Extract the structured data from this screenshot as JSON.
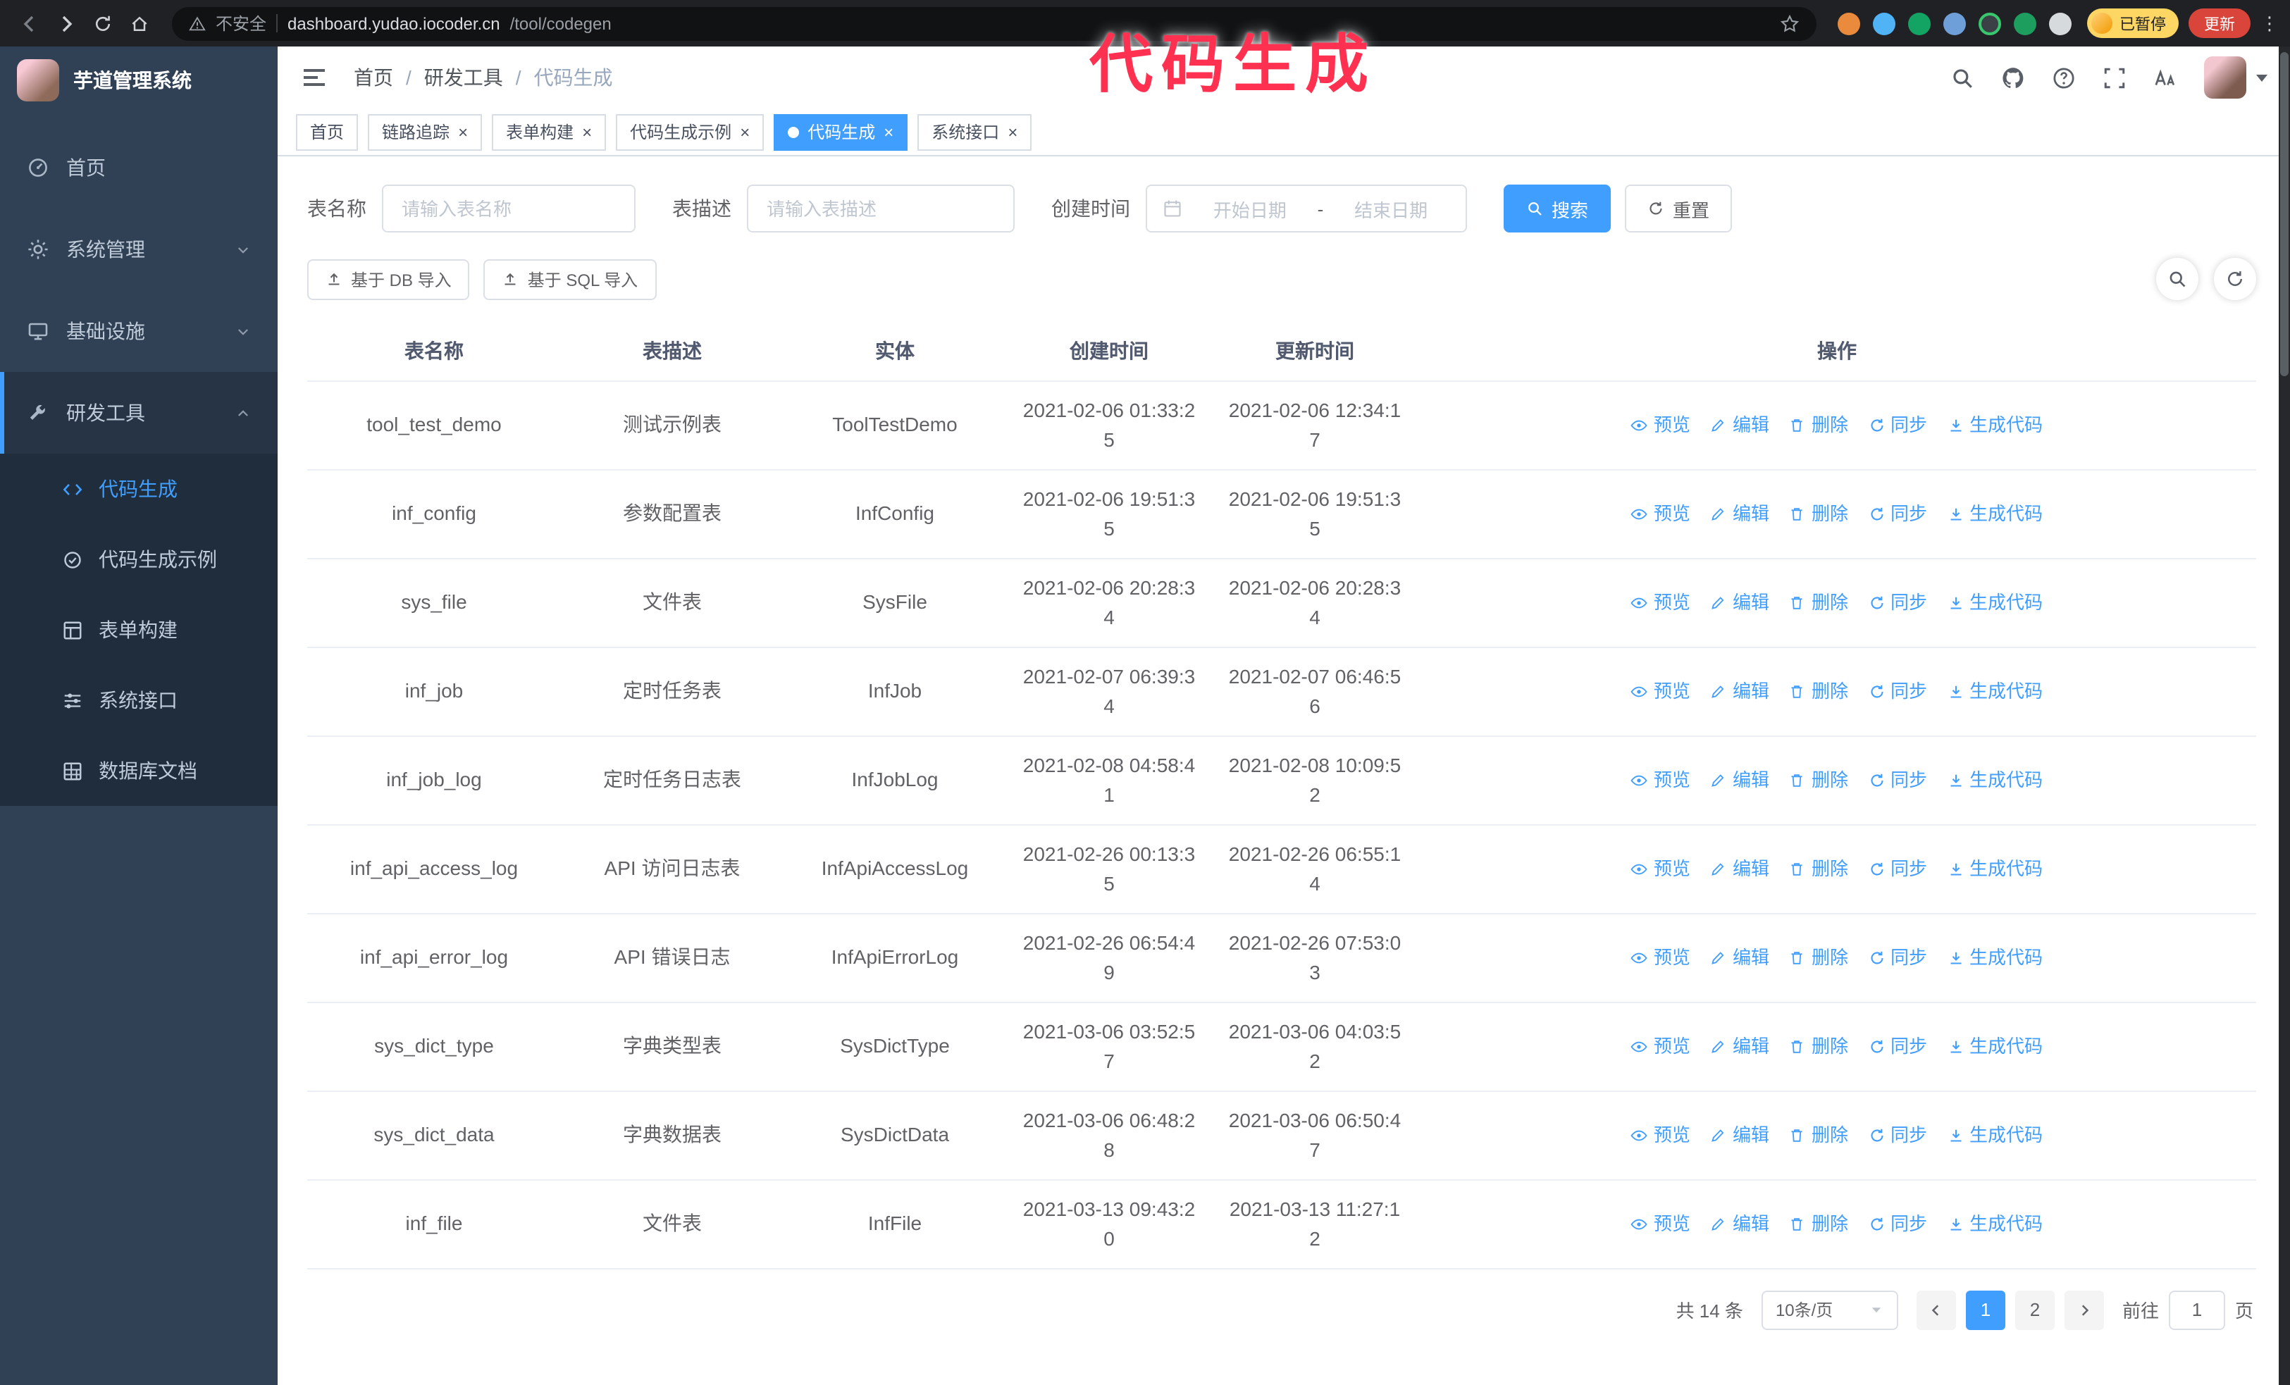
{
  "annotation": "代码生成",
  "browser": {
    "warning_label": "不安全",
    "url_domain": "dashboard.yudao.iocoder.cn",
    "url_path": "/tool/codegen",
    "paused_badge": "已暂停",
    "update_button": "更新"
  },
  "sidebar": {
    "logo_title": "芋道管理系统",
    "menu": [
      {
        "label": "首页"
      },
      {
        "label": "系统管理"
      },
      {
        "label": "基础设施"
      },
      {
        "label": "研发工具"
      }
    ],
    "submenu": [
      {
        "label": "代码生成"
      },
      {
        "label": "代码生成示例"
      },
      {
        "label": "表单构建"
      },
      {
        "label": "系统接口"
      },
      {
        "label": "数据库文档"
      }
    ]
  },
  "header": {
    "breadcrumb": [
      "首页",
      "研发工具",
      "代码生成"
    ]
  },
  "tabs": [
    "首页",
    "链路追踪",
    "表单构建",
    "代码生成示例",
    "代码生成",
    "系统接口"
  ],
  "filters": {
    "table_name_label": "表名称",
    "table_name_placeholder": "请输入表名称",
    "table_desc_label": "表描述",
    "table_desc_placeholder": "请输入表描述",
    "create_time_label": "创建时间",
    "start_placeholder": "开始日期",
    "range_separator": "-",
    "end_placeholder": "结束日期",
    "search_button": "搜索",
    "reset_button": "重置"
  },
  "toolbar": {
    "import_db_button": "基于 DB 导入",
    "import_sql_button": "基于 SQL 导入"
  },
  "table": {
    "columns": [
      "表名称",
      "表描述",
      "实体",
      "创建时间",
      "更新时间",
      "操作"
    ],
    "actions": [
      "预览",
      "编辑",
      "删除",
      "同步",
      "生成代码"
    ],
    "rows": [
      {
        "name": "tool_test_demo",
        "desc": "测试示例表",
        "entity": "ToolTestDemo",
        "created": "2021-02-06 01:33:25",
        "updated": "2021-02-06 12:34:17"
      },
      {
        "name": "inf_config",
        "desc": "参数配置表",
        "entity": "InfConfig",
        "created": "2021-02-06 19:51:35",
        "updated": "2021-02-06 19:51:35"
      },
      {
        "name": "sys_file",
        "desc": "文件表",
        "entity": "SysFile",
        "created": "2021-02-06 20:28:34",
        "updated": "2021-02-06 20:28:34"
      },
      {
        "name": "inf_job",
        "desc": "定时任务表",
        "entity": "InfJob",
        "created": "2021-02-07 06:39:34",
        "updated": "2021-02-07 06:46:56"
      },
      {
        "name": "inf_job_log",
        "desc": "定时任务日志表",
        "entity": "InfJobLog",
        "created": "2021-02-08 04:58:41",
        "updated": "2021-02-08 10:09:52"
      },
      {
        "name": "inf_api_access_log",
        "desc": "API 访问日志表",
        "entity": "InfApiAccessLog",
        "created": "2021-02-26 00:13:35",
        "updated": "2021-02-26 06:55:14"
      },
      {
        "name": "inf_api_error_log",
        "desc": "API 错误日志",
        "entity": "InfApiErrorLog",
        "created": "2021-02-26 06:54:49",
        "updated": "2021-02-26 07:53:03"
      },
      {
        "name": "sys_dict_type",
        "desc": "字典类型表",
        "entity": "SysDictType",
        "created": "2021-03-06 03:52:57",
        "updated": "2021-03-06 04:03:52"
      },
      {
        "name": "sys_dict_data",
        "desc": "字典数据表",
        "entity": "SysDictData",
        "created": "2021-03-06 06:48:28",
        "updated": "2021-03-06 06:50:47"
      },
      {
        "name": "inf_file",
        "desc": "文件表",
        "entity": "InfFile",
        "created": "2021-03-13 09:43:20",
        "updated": "2021-03-13 11:27:12"
      }
    ]
  },
  "pagination": {
    "total": "共 14 条",
    "page_size": "10条/页",
    "pages": [
      "1",
      "2"
    ],
    "goto_label": "前往",
    "goto_value": "1",
    "goto_unit": "页"
  },
  "colors": {
    "accent": "#409eff",
    "sidebar_bg": "#304156",
    "submenu_bg": "#1f2d3d",
    "annotation_pink": "#ff3050"
  }
}
